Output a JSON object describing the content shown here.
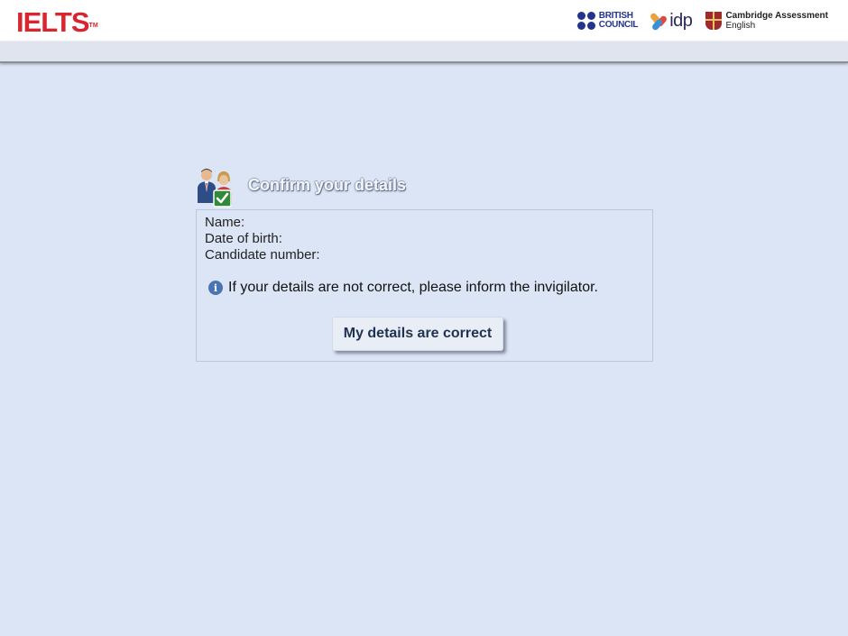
{
  "header": {
    "brand": "IELTS",
    "brand_tm": "TM",
    "partners": {
      "british_council_line1": "BRITISH",
      "british_council_line2": "COUNCIL",
      "idp": "idp",
      "cambridge_line1": "Cambridge Assessment",
      "cambridge_line2": "English"
    }
  },
  "dialog": {
    "title": "Confirm your details",
    "icon": "users-check-icon",
    "fields": {
      "name_label": "Name:",
      "dob_label": "Date of birth:",
      "candidate_label": "Candidate number:"
    },
    "notice": "If your details are not correct, please inform the invigilator.",
    "confirm_button": "My details are correct"
  },
  "colors": {
    "background": "#dce5f5",
    "brand_red": "#d7262e",
    "british_council_blue": "#23348c",
    "info_blue": "#4b74b3",
    "button_text": "#1f3350"
  }
}
